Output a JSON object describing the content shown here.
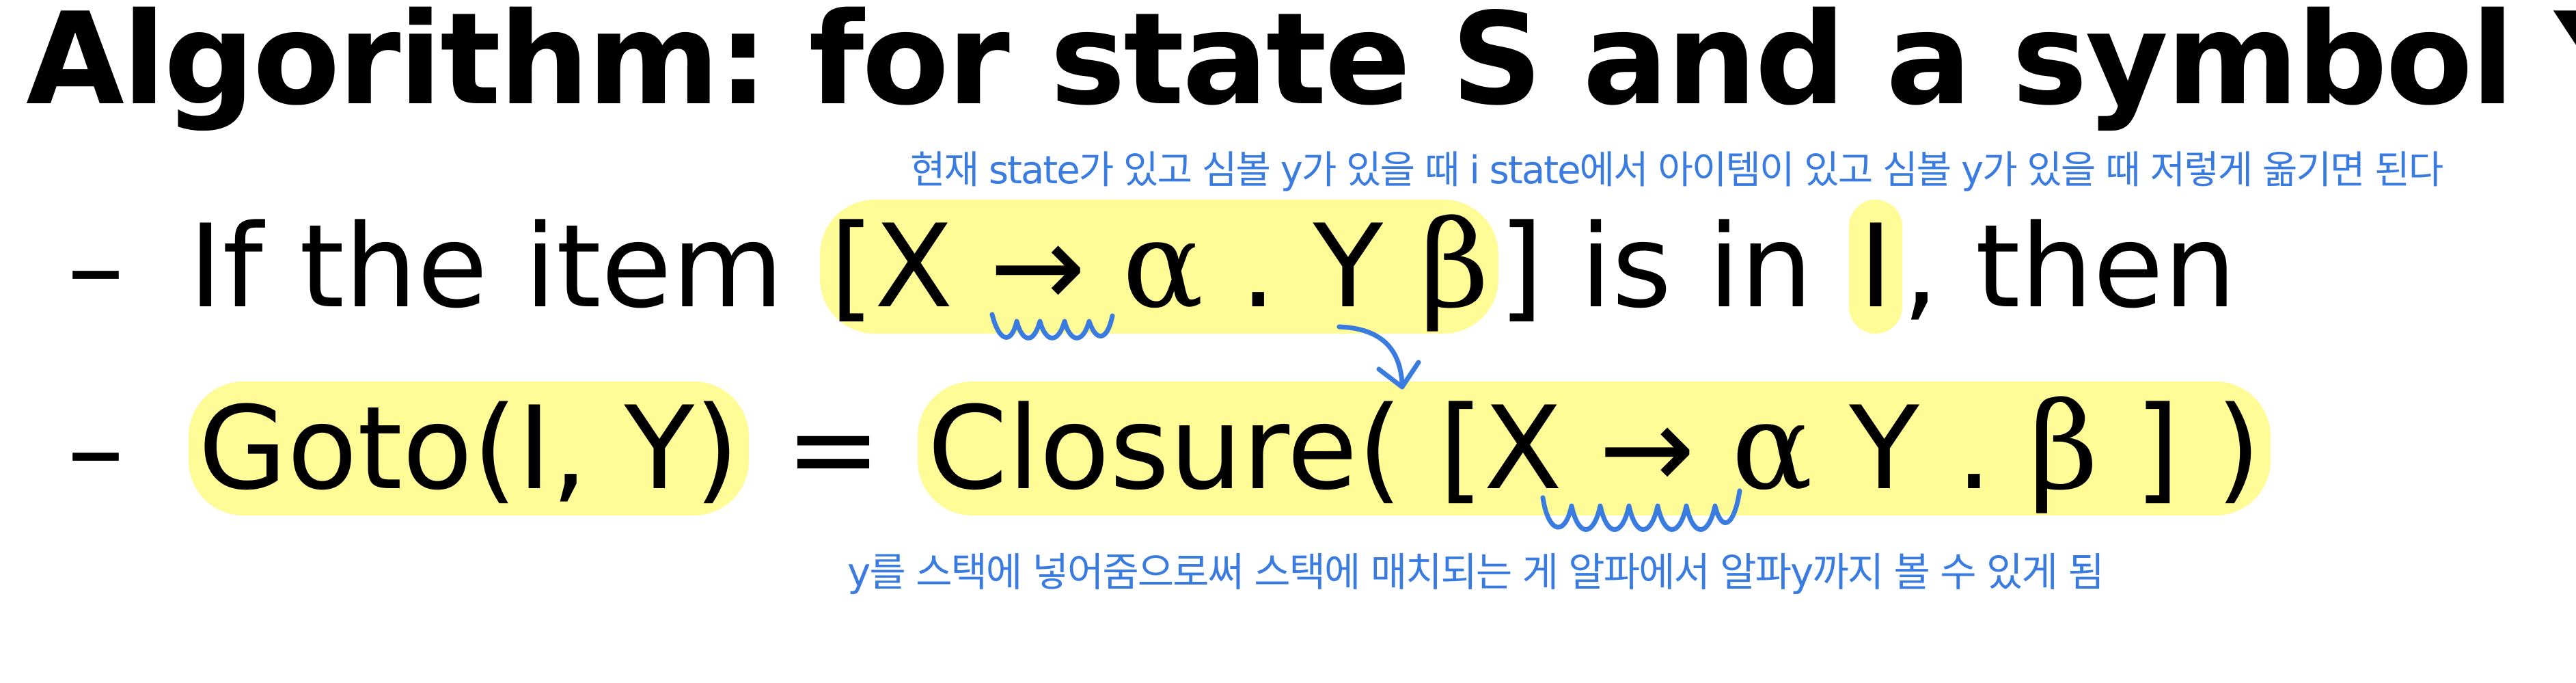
{
  "slide": {
    "title": "Algorithm: for state S and a symbol Y",
    "bullet_1": {
      "dash": "–",
      "prefix": "If the item ",
      "item_open": "[X",
      "arrow": " → ",
      "alpha": "α",
      "dot_y": " . Y ",
      "beta": "β",
      "item_close": "]",
      "middle": " is in ",
      "set": "I",
      "suffix": ", then"
    },
    "bullet_2": {
      "dash": "–",
      "goto": "Goto(I, Y)",
      "equals": " = ",
      "closure_open": "Closure( [X",
      "arrow": " → ",
      "alpha": "α",
      "y_dot": " Y . ",
      "beta": "β",
      "closure_close": " ] )"
    }
  },
  "annotations": {
    "note_top": "현재 state가 있고 심볼 y가 있을 때 i state에서 아이템이 있고 심볼 y가 있을 때 저렇게 옮기면 된다",
    "note_bottom": "y를 스택에 넣어줌으로써 스택에 매치되는 게 알파에서 알파y까지 볼 수 있게 됨",
    "ink_color": "#3a7be0",
    "highlight_color": "#fff878"
  }
}
